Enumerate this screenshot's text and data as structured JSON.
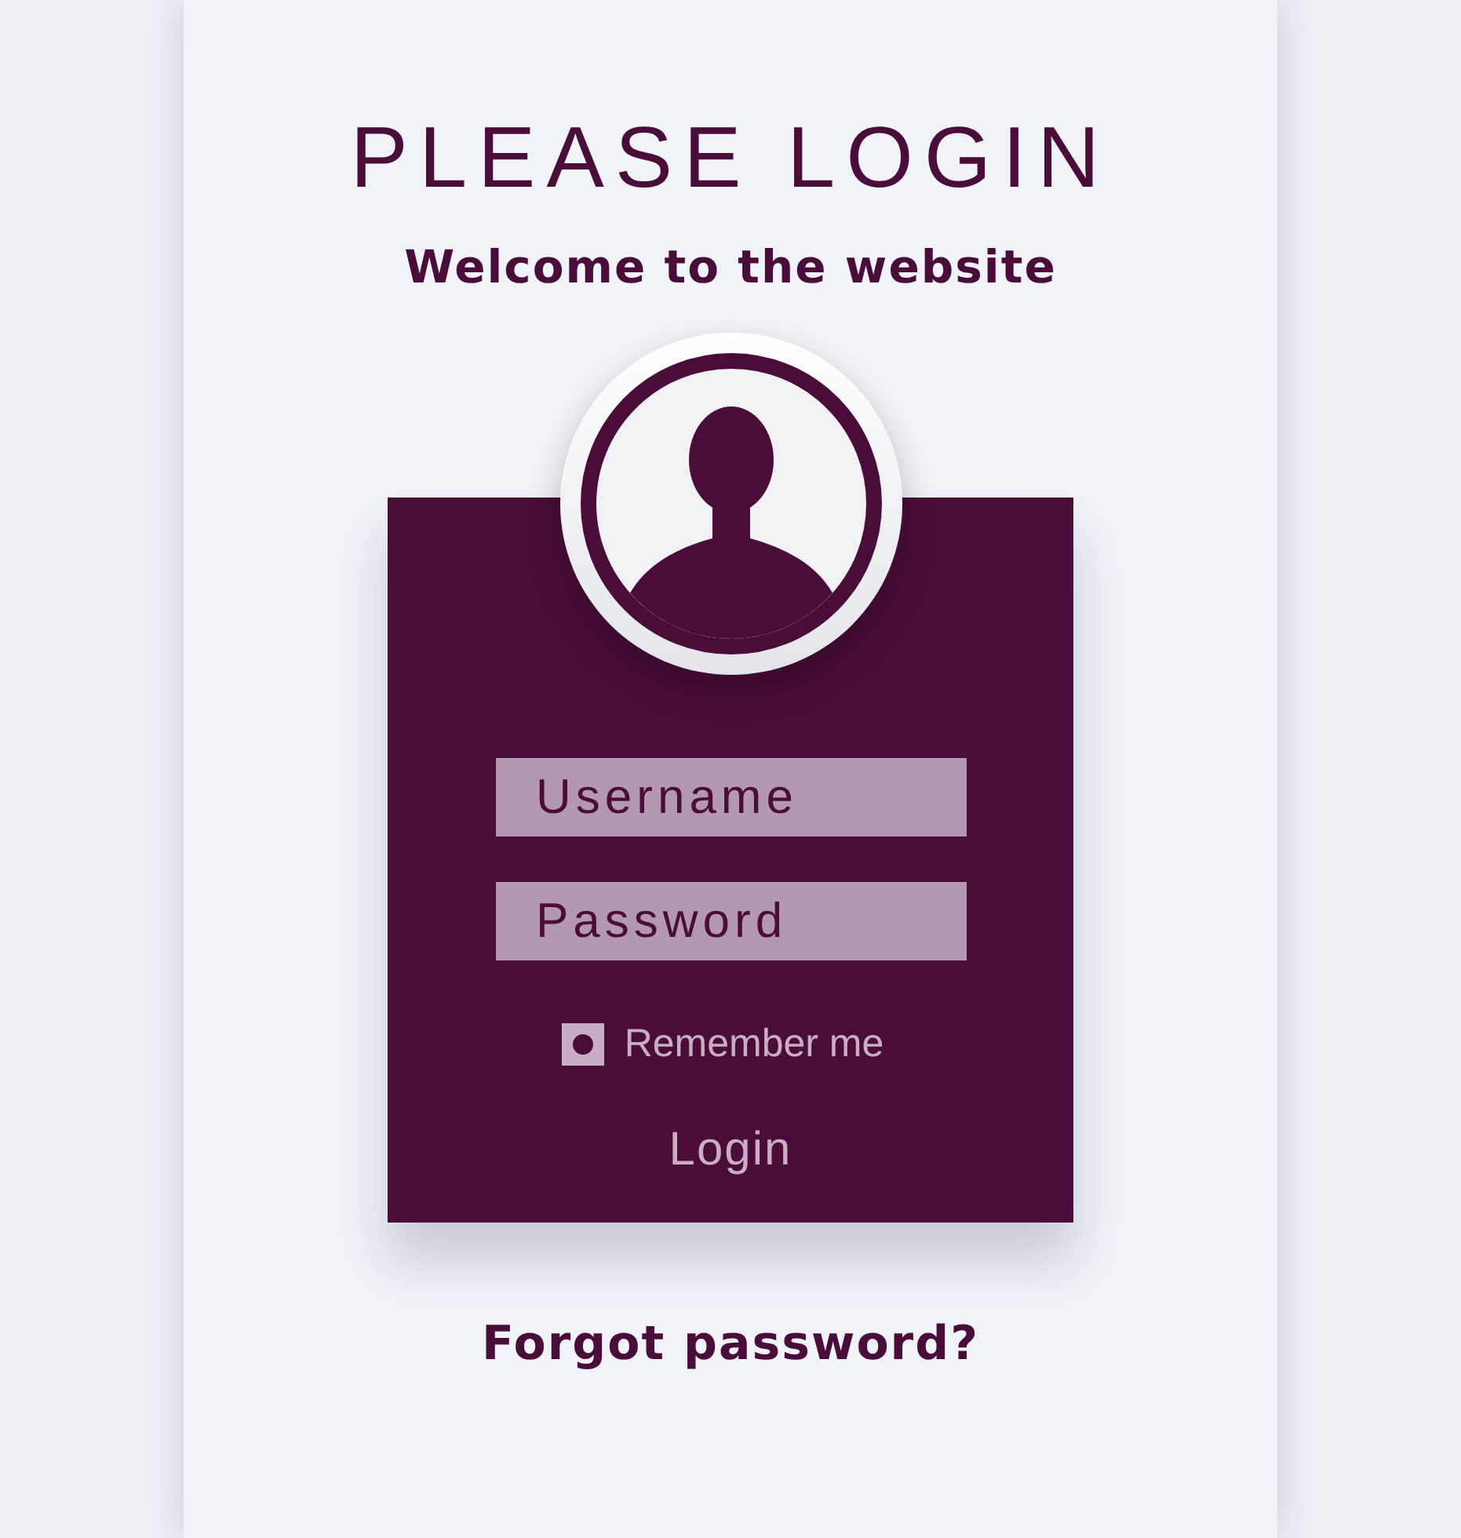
{
  "title": "PLEASE LOGIN",
  "subtitle": "Welcome to the website",
  "form": {
    "username": {
      "placeholder": "Username"
    },
    "password": {
      "placeholder": "Password"
    },
    "remember": {
      "label": "Remember me",
      "checked": true
    },
    "login_button": "Login"
  },
  "forgot_link": "Forgot password?"
}
